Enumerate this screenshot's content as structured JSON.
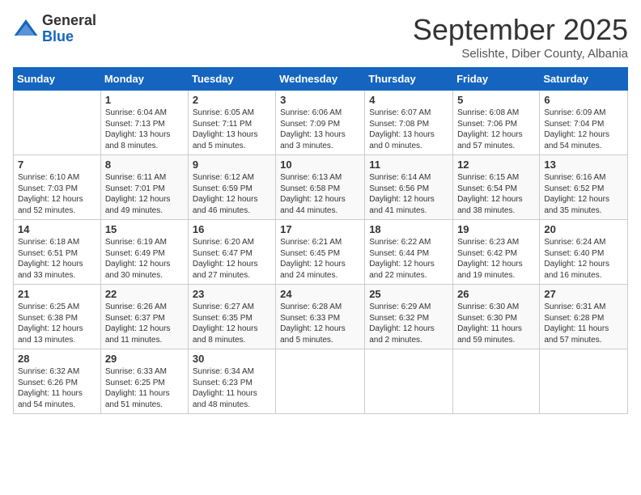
{
  "logo": {
    "general": "General",
    "blue": "Blue"
  },
  "title": "September 2025",
  "subtitle": "Selishte, Diber County, Albania",
  "days_of_week": [
    "Sunday",
    "Monday",
    "Tuesday",
    "Wednesday",
    "Thursday",
    "Friday",
    "Saturday"
  ],
  "weeks": [
    [
      {
        "day": "",
        "sunrise": "",
        "sunset": "",
        "daylight": ""
      },
      {
        "day": "1",
        "sunrise": "Sunrise: 6:04 AM",
        "sunset": "Sunset: 7:13 PM",
        "daylight": "Daylight: 13 hours and 8 minutes."
      },
      {
        "day": "2",
        "sunrise": "Sunrise: 6:05 AM",
        "sunset": "Sunset: 7:11 PM",
        "daylight": "Daylight: 13 hours and 5 minutes."
      },
      {
        "day": "3",
        "sunrise": "Sunrise: 6:06 AM",
        "sunset": "Sunset: 7:09 PM",
        "daylight": "Daylight: 13 hours and 3 minutes."
      },
      {
        "day": "4",
        "sunrise": "Sunrise: 6:07 AM",
        "sunset": "Sunset: 7:08 PM",
        "daylight": "Daylight: 13 hours and 0 minutes."
      },
      {
        "day": "5",
        "sunrise": "Sunrise: 6:08 AM",
        "sunset": "Sunset: 7:06 PM",
        "daylight": "Daylight: 12 hours and 57 minutes."
      },
      {
        "day": "6",
        "sunrise": "Sunrise: 6:09 AM",
        "sunset": "Sunset: 7:04 PM",
        "daylight": "Daylight: 12 hours and 54 minutes."
      }
    ],
    [
      {
        "day": "7",
        "sunrise": "Sunrise: 6:10 AM",
        "sunset": "Sunset: 7:03 PM",
        "daylight": "Daylight: 12 hours and 52 minutes."
      },
      {
        "day": "8",
        "sunrise": "Sunrise: 6:11 AM",
        "sunset": "Sunset: 7:01 PM",
        "daylight": "Daylight: 12 hours and 49 minutes."
      },
      {
        "day": "9",
        "sunrise": "Sunrise: 6:12 AM",
        "sunset": "Sunset: 6:59 PM",
        "daylight": "Daylight: 12 hours and 46 minutes."
      },
      {
        "day": "10",
        "sunrise": "Sunrise: 6:13 AM",
        "sunset": "Sunset: 6:58 PM",
        "daylight": "Daylight: 12 hours and 44 minutes."
      },
      {
        "day": "11",
        "sunrise": "Sunrise: 6:14 AM",
        "sunset": "Sunset: 6:56 PM",
        "daylight": "Daylight: 12 hours and 41 minutes."
      },
      {
        "day": "12",
        "sunrise": "Sunrise: 6:15 AM",
        "sunset": "Sunset: 6:54 PM",
        "daylight": "Daylight: 12 hours and 38 minutes."
      },
      {
        "day": "13",
        "sunrise": "Sunrise: 6:16 AM",
        "sunset": "Sunset: 6:52 PM",
        "daylight": "Daylight: 12 hours and 35 minutes."
      }
    ],
    [
      {
        "day": "14",
        "sunrise": "Sunrise: 6:18 AM",
        "sunset": "Sunset: 6:51 PM",
        "daylight": "Daylight: 12 hours and 33 minutes."
      },
      {
        "day": "15",
        "sunrise": "Sunrise: 6:19 AM",
        "sunset": "Sunset: 6:49 PM",
        "daylight": "Daylight: 12 hours and 30 minutes."
      },
      {
        "day": "16",
        "sunrise": "Sunrise: 6:20 AM",
        "sunset": "Sunset: 6:47 PM",
        "daylight": "Daylight: 12 hours and 27 minutes."
      },
      {
        "day": "17",
        "sunrise": "Sunrise: 6:21 AM",
        "sunset": "Sunset: 6:45 PM",
        "daylight": "Daylight: 12 hours and 24 minutes."
      },
      {
        "day": "18",
        "sunrise": "Sunrise: 6:22 AM",
        "sunset": "Sunset: 6:44 PM",
        "daylight": "Daylight: 12 hours and 22 minutes."
      },
      {
        "day": "19",
        "sunrise": "Sunrise: 6:23 AM",
        "sunset": "Sunset: 6:42 PM",
        "daylight": "Daylight: 12 hours and 19 minutes."
      },
      {
        "day": "20",
        "sunrise": "Sunrise: 6:24 AM",
        "sunset": "Sunset: 6:40 PM",
        "daylight": "Daylight: 12 hours and 16 minutes."
      }
    ],
    [
      {
        "day": "21",
        "sunrise": "Sunrise: 6:25 AM",
        "sunset": "Sunset: 6:38 PM",
        "daylight": "Daylight: 12 hours and 13 minutes."
      },
      {
        "day": "22",
        "sunrise": "Sunrise: 6:26 AM",
        "sunset": "Sunset: 6:37 PM",
        "daylight": "Daylight: 12 hours and 11 minutes."
      },
      {
        "day": "23",
        "sunrise": "Sunrise: 6:27 AM",
        "sunset": "Sunset: 6:35 PM",
        "daylight": "Daylight: 12 hours and 8 minutes."
      },
      {
        "day": "24",
        "sunrise": "Sunrise: 6:28 AM",
        "sunset": "Sunset: 6:33 PM",
        "daylight": "Daylight: 12 hours and 5 minutes."
      },
      {
        "day": "25",
        "sunrise": "Sunrise: 6:29 AM",
        "sunset": "Sunset: 6:32 PM",
        "daylight": "Daylight: 12 hours and 2 minutes."
      },
      {
        "day": "26",
        "sunrise": "Sunrise: 6:30 AM",
        "sunset": "Sunset: 6:30 PM",
        "daylight": "Daylight: 11 hours and 59 minutes."
      },
      {
        "day": "27",
        "sunrise": "Sunrise: 6:31 AM",
        "sunset": "Sunset: 6:28 PM",
        "daylight": "Daylight: 11 hours and 57 minutes."
      }
    ],
    [
      {
        "day": "28",
        "sunrise": "Sunrise: 6:32 AM",
        "sunset": "Sunset: 6:26 PM",
        "daylight": "Daylight: 11 hours and 54 minutes."
      },
      {
        "day": "29",
        "sunrise": "Sunrise: 6:33 AM",
        "sunset": "Sunset: 6:25 PM",
        "daylight": "Daylight: 11 hours and 51 minutes."
      },
      {
        "day": "30",
        "sunrise": "Sunrise: 6:34 AM",
        "sunset": "Sunset: 6:23 PM",
        "daylight": "Daylight: 11 hours and 48 minutes."
      },
      {
        "day": "",
        "sunrise": "",
        "sunset": "",
        "daylight": ""
      },
      {
        "day": "",
        "sunrise": "",
        "sunset": "",
        "daylight": ""
      },
      {
        "day": "",
        "sunrise": "",
        "sunset": "",
        "daylight": ""
      },
      {
        "day": "",
        "sunrise": "",
        "sunset": "",
        "daylight": ""
      }
    ]
  ]
}
